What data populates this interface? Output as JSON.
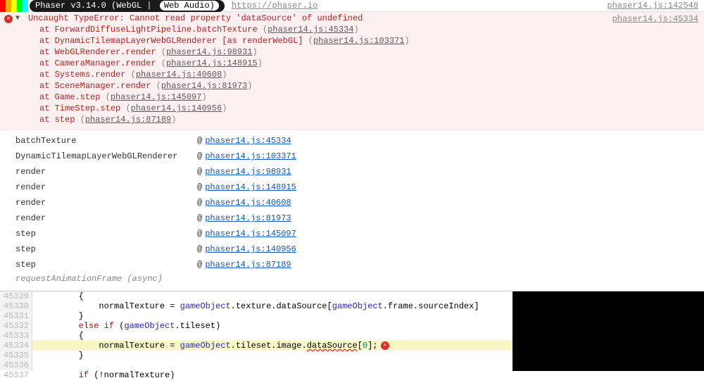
{
  "header": {
    "color_bars": [
      "#ff0000",
      "#ffa500",
      "#ffff00",
      "#00ff00",
      "#00ffff"
    ],
    "phaser_label_prefix": "Phaser v3.14.0 (WebGL | ",
    "phaser_label_highlight": "Web Audio)",
    "phaser_url": "https://phaser.io",
    "right_link": "phaser14.js:142548"
  },
  "error": {
    "message": "Uncaught TypeError: Cannot read property 'dataSource' of undefined",
    "right_link": "phaser14.js:45334",
    "stack": [
      {
        "prefix": "at ",
        "fn": "ForwardDiffuseLightPipeline.batchTexture",
        "loc": "phaser14.js:45334"
      },
      {
        "prefix": "at ",
        "fn": "DynamicTilemapLayerWebGLRenderer [as renderWebGL]",
        "loc": "phaser14.js:103371"
      },
      {
        "prefix": "at ",
        "fn": "WebGLRenderer.render",
        "loc": "phaser14.js:98931"
      },
      {
        "prefix": "at ",
        "fn": "CameraManager.render",
        "loc": "phaser14.js:148915"
      },
      {
        "prefix": "at ",
        "fn": "Systems.render",
        "loc": "phaser14.js:40608"
      },
      {
        "prefix": "at ",
        "fn": "SceneManager.render",
        "loc": "phaser14.js:81973"
      },
      {
        "prefix": "at ",
        "fn": "Game.step",
        "loc": "phaser14.js:145097"
      },
      {
        "prefix": "at ",
        "fn": "TimeStep.step",
        "loc": "phaser14.js:140956"
      },
      {
        "prefix": "at ",
        "fn": "step",
        "loc": "phaser14.js:87189"
      }
    ]
  },
  "trace_table": [
    {
      "fn": "batchTexture",
      "loc": "phaser14.js:45334"
    },
    {
      "fn": "DynamicTilemapLayerWebGLRenderer",
      "loc": "phaser14.js:103371"
    },
    {
      "fn": "render",
      "loc": "phaser14.js:98931"
    },
    {
      "fn": "render",
      "loc": "phaser14.js:148915"
    },
    {
      "fn": "render",
      "loc": "phaser14.js:40608"
    },
    {
      "fn": "render",
      "loc": "phaser14.js:81973"
    },
    {
      "fn": "step",
      "loc": "phaser14.js:145097"
    },
    {
      "fn": "step",
      "loc": "phaser14.js:140956"
    },
    {
      "fn": "step",
      "loc": "phaser14.js:87189"
    }
  ],
  "async_label": "requestAnimationFrame (async)",
  "at_symbol": "@",
  "source": {
    "gutter": [
      "45329",
      "45330",
      "45331",
      "45332",
      "45333",
      "45334",
      "45335",
      "45336",
      "45337"
    ],
    "lines": {
      "l0": "        {",
      "l1_a": "            normalTexture = ",
      "l1_go": "gameObject",
      "l1_b": ".texture.dataSource[",
      "l1_go2": "gameObject",
      "l1_c": ".frame.sourceIndex]",
      "l2": "        }",
      "l3_a": "        ",
      "l3_kw": "else if",
      "l3_b": " (",
      "l3_go": "gameObject",
      "l3_c": ".tileset)",
      "l4": "        {",
      "l5_a": "            normalTexture = ",
      "l5_go": "gameObject",
      "l5_b": ".tileset.image.",
      "l5_ds": "dataSource",
      "l5_c": "[",
      "l5_n": "0",
      "l5_d": "];",
      "l6": "        }",
      "l7": "",
      "l8_a": "        ",
      "l8_kw": "if",
      "l8_b": " (!normalTexture)"
    }
  }
}
